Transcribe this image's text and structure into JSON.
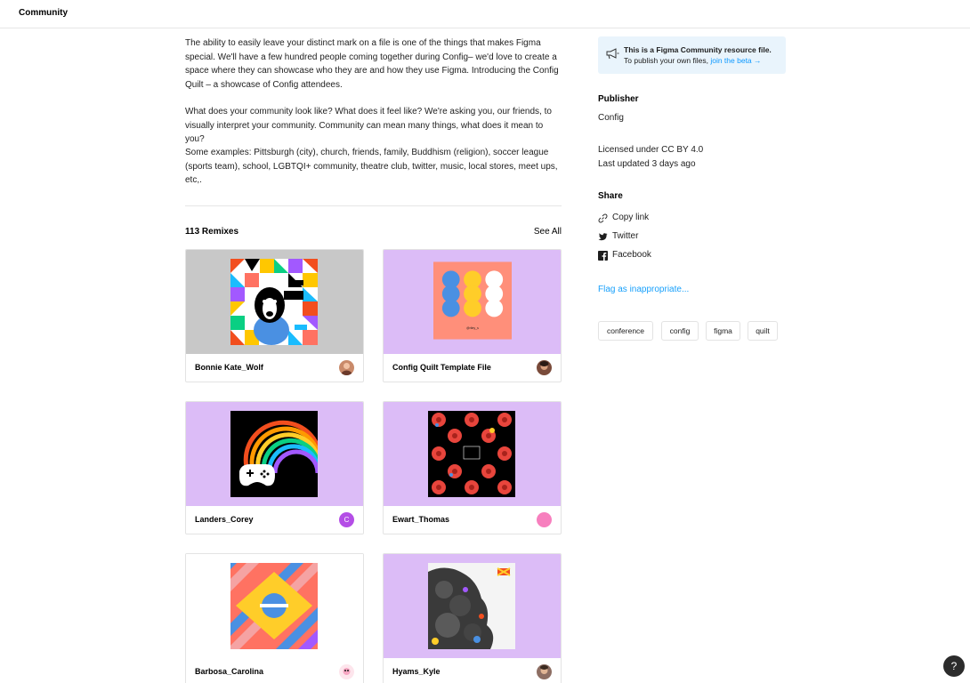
{
  "topbar": {
    "title": "Community"
  },
  "description": {
    "p1": "The ability to easily leave your distinct mark on a file is one of the things that makes Figma special. We'll have a few hundred people coming together during Config– we'd love to create a space where they can showcase who they are and how they use Figma. Introducing the Config Quilt –  a showcase of Config attendees.",
    "p2": "What does your community look like? What does it feel like? We're asking you, our friends, to visually interpret your community. Community can mean many things, what does it mean to you?",
    "p3": "Some examples: Pittsburgh (city), church, friends, family, Buddhism (religion), soccer league (sports team), school, LGBTQI+ community, theatre club, twitter, music, local stores, meet ups, etc,."
  },
  "remixes": {
    "count_label": "113 Remixes",
    "see_all": "See All",
    "items": [
      {
        "name": "Bonnie Kate_Wolf",
        "thumb_bg": "#c8c8c8",
        "avatar": "photo"
      },
      {
        "name": "Config Quilt Template File",
        "thumb_bg": "#dcbcf7",
        "art_label": "@riley_s",
        "avatar": "photo"
      },
      {
        "name": "Landers_Corey",
        "thumb_bg": "#dcbcf7",
        "avatar": "C",
        "avatar_color": "#b44ee6"
      },
      {
        "name": "Ewart_Thomas",
        "thumb_bg": "#dcbcf7",
        "avatar": "",
        "avatar_color": "#f77fbe"
      },
      {
        "name": "Barbosa_Carolina",
        "thumb_bg": "#ffffff",
        "avatar": "photo"
      },
      {
        "name": "Hyams_Kyle",
        "thumb_bg": "#dcbcf7",
        "avatar": "photo"
      }
    ]
  },
  "sidebar": {
    "notice": {
      "title": "This is a Figma Community resource file.",
      "text": "To publish your own files,",
      "link": "join the beta →"
    },
    "publisher_heading": "Publisher",
    "publisher": "Config",
    "license": "Licensed under CC BY 4.0",
    "updated": "Last updated 3 days ago",
    "share_heading": "Share",
    "share": {
      "copy_link": "Copy link",
      "twitter": "Twitter",
      "facebook": "Facebook"
    },
    "flag": "Flag as inappropriate...",
    "tags": [
      "conference",
      "config",
      "figma",
      "quilt"
    ]
  },
  "help": {
    "label": "?"
  },
  "colors": {
    "accent": "#18a0fb",
    "notice_bg": "#e9f4fc",
    "card_purple": "#dcbcf7"
  }
}
